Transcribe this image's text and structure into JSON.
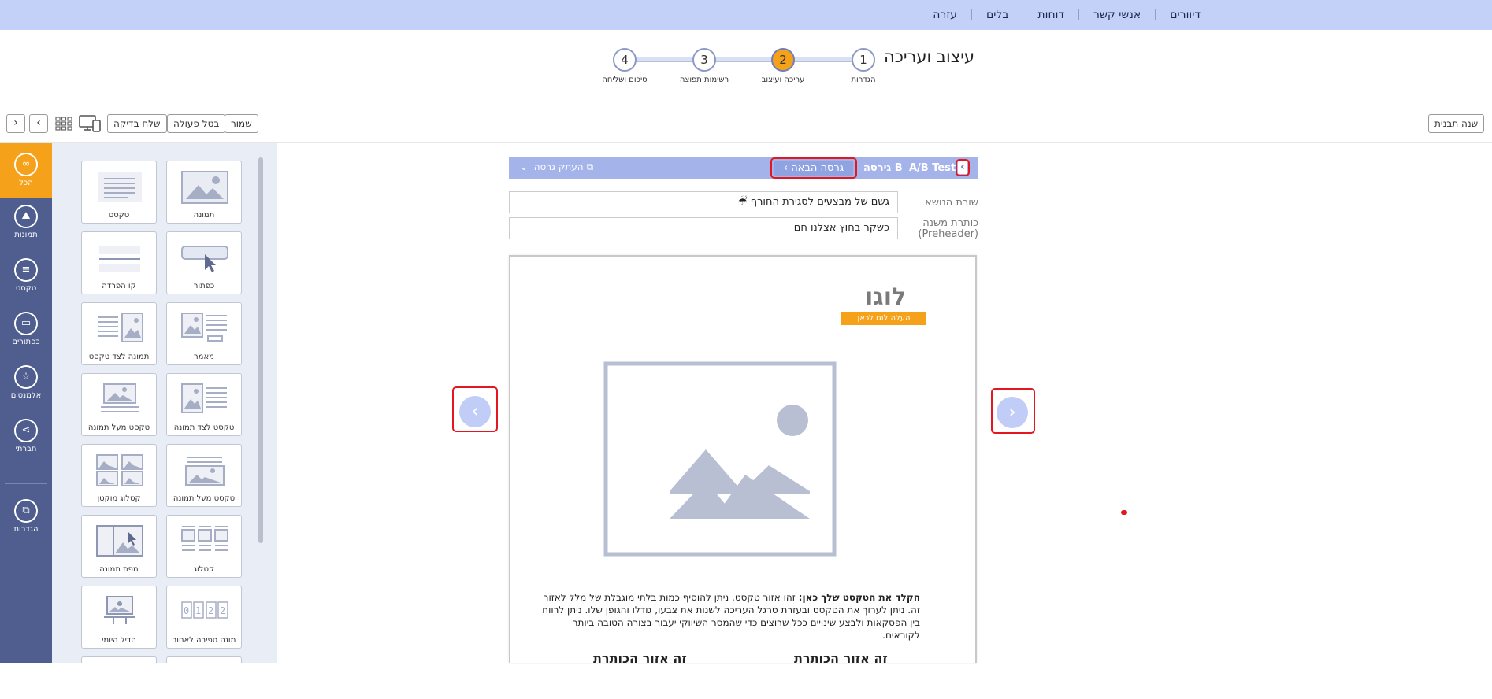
{
  "topnav": {
    "items": [
      "דיוורים",
      "אנשי קשר",
      "דוחות",
      "בלים",
      "עזרה"
    ]
  },
  "stepper": {
    "title": "עיצוב ועריכה",
    "steps": [
      {
        "num": "1",
        "label": "הגדרות"
      },
      {
        "num": "2",
        "label": "עריכה ועיצוב"
      },
      {
        "num": "3",
        "label": "רשימות תפוצה"
      },
      {
        "num": "4",
        "label": "סיכום ושליחה"
      }
    ],
    "active_step": 2
  },
  "toolbar": {
    "save": "שמור",
    "undo": "בטל פעולה",
    "send_test": "שלח בדיקה",
    "change_template": "שנה תבנית",
    "prev": "‹",
    "next": "›"
  },
  "sidebar": {
    "items": [
      {
        "label": "הכל",
        "icon": "infinity-icon"
      },
      {
        "label": "תמונות",
        "icon": "image-icon"
      },
      {
        "label": "טקסט",
        "icon": "text-icon"
      },
      {
        "label": "כפתורים",
        "icon": "button-icon"
      },
      {
        "label": "אלמנטים",
        "icon": "star-icon"
      },
      {
        "label": "חברתי",
        "icon": "share-icon"
      },
      {
        "label": "הגדרות",
        "icon": "settings-icon"
      }
    ]
  },
  "blocks": [
    {
      "label": "תמונה"
    },
    {
      "label": "טקסט"
    },
    {
      "label": "כפתור"
    },
    {
      "label": "קו הפרדה"
    },
    {
      "label": "מאמר"
    },
    {
      "label": "תמונה לצד טקסט"
    },
    {
      "label": "טקסט לצד תמונה"
    },
    {
      "label": "טקסט מעל תמונה"
    },
    {
      "label": "טקסט מעל תמונה"
    },
    {
      "label": "קטלוג מוקטן"
    },
    {
      "label": "קטלוג"
    },
    {
      "label": "מפת תמונה"
    },
    {
      "label": "מונה ספירה לאחור"
    },
    {
      "label": "הדיל היומי"
    }
  ],
  "ab": {
    "test_label": "A/B Test",
    "version": "גירסה B",
    "next_version": "גרסה הבאה",
    "copy_version": "העתק גרסה"
  },
  "fields": {
    "subject_label": "שורת הנושא",
    "subject_value": "גשם של מבצעים לסגירת החורף",
    "preheader_label": "כותרת משנה",
    "preheader_label2": "(Preheader)",
    "preheader_value": "כשקר בחוץ אצלנו חם"
  },
  "email": {
    "logo": "לוגו",
    "upload_logo": "העלה לוגו לכאן",
    "text_bold": "הקלד את הטקסט שלך כאן:",
    "text_body": "זהו אזור טקסט. ניתן להוסיף כמות בלתי מוגבלת של מלל לאזור זה. ניתן לערוך את הטקסט ובעזרת סרגל העריכה לשנות את צבעו, גודלו והגופן שלו. ניתן לרווח בין הפסקאות ולבצע שינויים ככל שרוצים כדי שהמסר השיווקי יעבור בצורה הטובה ביותר לקוראים.",
    "col1_title": "זה אזור הכותרת",
    "col2_title": "זה אזור הכותרת"
  },
  "colors": {
    "accent": "#f5a11a",
    "nav_bg": "#c3d0f7",
    "sidebar_bg": "#4f5d8f",
    "ab_bar": "#a4b4ea",
    "highlight": "#e4161f"
  }
}
